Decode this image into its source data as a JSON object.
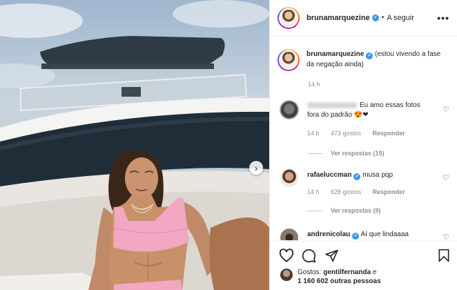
{
  "post": {
    "username": "brunamarquezine",
    "follow_label": "A seguir",
    "more_label": "•••",
    "caption_text": "(estou vivendo a fase da negação ainda)",
    "caption_time": "14 h"
  },
  "comments": [
    {
      "username": "",
      "text": "Eu amo essas fotos fora do padrão 😍❤",
      "time": "14 h",
      "likes": "473 gostos",
      "reply": "Responder",
      "view_replies": "Ver respostas (15)"
    },
    {
      "username": "rafaeluccman",
      "text": "musa pqp",
      "time": "14 h",
      "likes": "628 gostos",
      "reply": "Responder",
      "view_replies": "Ver respostas (9)"
    },
    {
      "username": "andrenicolau",
      "text": "Aí que lindaaaa"
    }
  ],
  "likes": {
    "prefix": "Gostos: ",
    "user": "gentilfernanda",
    "joiner": " e",
    "others": "1 160 602 outras pessoas"
  },
  "icons": {
    "verified": "verified-badge-icon",
    "heart": "heart-icon",
    "comment": "comment-icon",
    "share": "share-icon",
    "bookmark": "bookmark-icon",
    "next": "chevron-right-icon"
  },
  "colors": {
    "verified": "#3897f0",
    "muted": "#8e8e8e",
    "text": "#262626",
    "bikini": "#f2a7c3"
  }
}
